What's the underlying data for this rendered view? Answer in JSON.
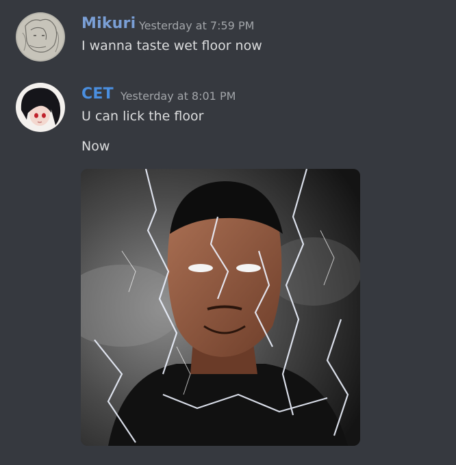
{
  "colors": {
    "background": "#36393f",
    "mikuri_name": "#7a9fd6",
    "cet_name": "#4a8fe0",
    "timestamp": "#a3a6aa",
    "message_text": "#dcddde"
  },
  "messages": [
    {
      "author": "Mikuri",
      "timestamp": "Yesterday at 7:59 PM",
      "lines": [
        "I wanna taste wet floor now"
      ],
      "avatar_icon": "anime-sketch-avatar-icon"
    },
    {
      "author": "CET",
      "timestamp": "Yesterday at 8:01 PM",
      "lines": [
        "U can lick the floor",
        "Now"
      ],
      "avatar_icon": "anime-dark-hair-avatar-icon",
      "attachment": {
        "kind": "gif",
        "icon": "lightning-meme-image"
      }
    }
  ]
}
